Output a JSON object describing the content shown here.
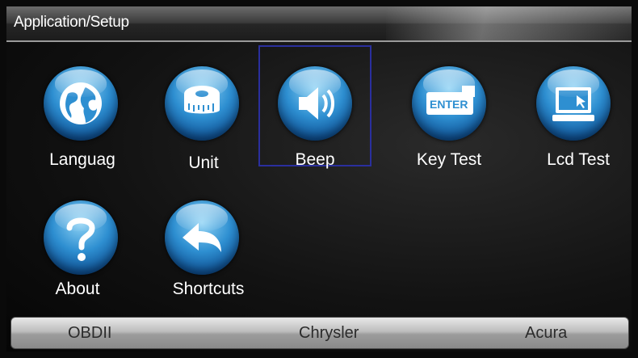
{
  "header": {
    "title": "Application/Setup"
  },
  "menu": [
    {
      "label": "Languag",
      "icon": "globe-icon"
    },
    {
      "label": "Unit",
      "icon": "tape-measure-icon"
    },
    {
      "label": "Beep",
      "icon": "speaker-icon",
      "selected": true
    },
    {
      "label": "Key Test",
      "icon": "enter-key-icon"
    },
    {
      "label": "Lcd Test",
      "icon": "monitor-icon"
    },
    {
      "label": "About",
      "icon": "question-mark-icon"
    },
    {
      "label": "Shortcuts",
      "icon": "back-arrow-icon"
    }
  ],
  "footer": {
    "items": [
      "OBDII",
      "Chrysler",
      "Acura"
    ]
  },
  "colors": {
    "selection_border": "#2a2f9e",
    "icon_blue": "#2e8fd1"
  }
}
